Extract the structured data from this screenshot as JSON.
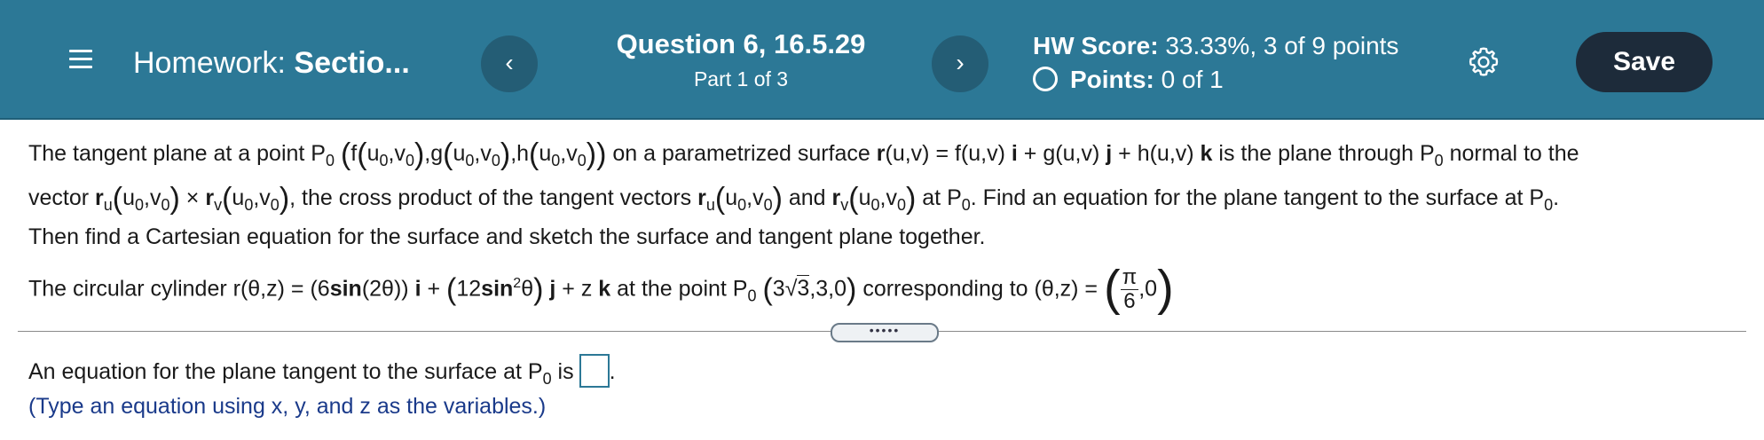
{
  "header": {
    "hw_label": "Homework:",
    "hw_name": "Sectio...",
    "prev_label": "‹",
    "next_label": "›",
    "question_title": "Question 6, 16.5.29",
    "question_part": "Part 1 of 3",
    "score_label": "HW Score:",
    "score_value": "33.33%, 3 of 9 points",
    "points_label": "Points:",
    "points_value": "0 of 1",
    "save_label": "Save",
    "colors": {
      "bar": "#2c7896",
      "save_bg": "#1d2b3a"
    }
  },
  "problem": {
    "l1_a": "The tangent plane at a point P",
    "sub0": "0",
    "l1_b": "f",
    "uv0": "u",
    "uv0_sub": "0",
    "v0": "v",
    "g": "g",
    "h": "h",
    "l1_c": "on a parametrized surface",
    "r_uv": "r",
    "l1_d": "(u,v) = f(u,v)",
    "i": "i",
    "plus": "+",
    "l1_e": "g(u,v)",
    "j": "j",
    "l1_f": "h(u,v)",
    "k": "k",
    "l1_g": "is the plane through P",
    "l1_h": "normal to the",
    "l2_a": "vector",
    "ru": "r",
    "u": "u",
    "times": "×",
    "rv": "r",
    "v": "v",
    "l2_b": ", the cross product of the tangent vectors",
    "and": "and",
    "l2_c": "at P",
    "l2_d": ". Find an equation for the plane tangent to the surface at P",
    "l2_e": ".",
    "l3": "Then find a Cartesian equation for the surface and sketch the surface and tangent plane together.",
    "l4_a": "The circular cylinder r(θ,z) = (6",
    "sin": "sin",
    "l4_b": "(2θ))",
    "l4_c": "12",
    "sin2": "sin",
    "sq": "2",
    "theta": "θ",
    "l4_d": "+ z",
    "l4_e": "at the point P",
    "pt_a": "3",
    "root": "√",
    "pt_b": "3",
    "pt_c": ",3,0",
    "l4_f": "corresponding to (θ,z) =",
    "pi": "π",
    "six": "6",
    "zero": ",0"
  },
  "divider": {
    "label": "•••••"
  },
  "answer": {
    "text_a": "An equation for the plane tangent to the surface at P",
    "sub0": "0",
    "text_b": "is",
    "period": ".",
    "hint": "(Type an equation using x, y, and z as the variables.)"
  }
}
